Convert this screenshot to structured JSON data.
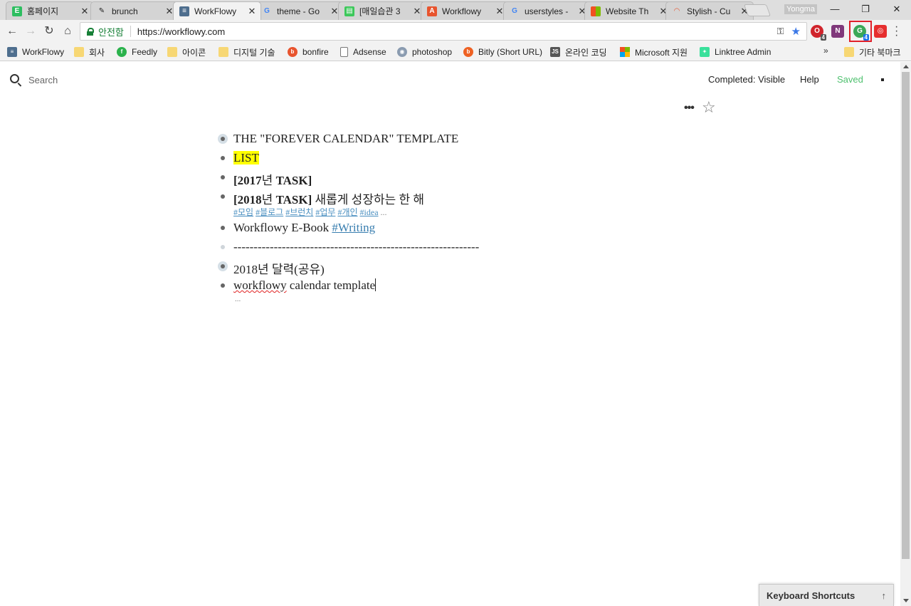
{
  "tabs": [
    {
      "title": "홈페이지",
      "icon": "evernote-icon",
      "color": "#2dbe60",
      "glyph": "E"
    },
    {
      "title": "brunch",
      "icon": "brunch-pen-icon",
      "color": "#ffffff",
      "glyph": "✎"
    },
    {
      "title": "WorkFlowy",
      "icon": "workflowy-icon",
      "color": "#4e6e8e",
      "glyph": "≡"
    },
    {
      "title": "theme - Go",
      "icon": "google-icon",
      "color": "#ffffff",
      "glyph": "G"
    },
    {
      "title": "[매일습관 3",
      "icon": "habit-icon",
      "color": "#3cc85a",
      "glyph": "▤"
    },
    {
      "title": "Workflowy",
      "icon": "workflowy-a-icon",
      "color": "#e8542e",
      "glyph": "A"
    },
    {
      "title": "userstyles -",
      "icon": "google-icon",
      "color": "#ffffff",
      "glyph": "G"
    },
    {
      "title": "Website Th",
      "icon": "microsoft-icon",
      "color": "#ffffff",
      "glyph": "▦"
    },
    {
      "title": "Stylish - Cu",
      "icon": "rainbow-icon",
      "color": "#ffffff",
      "glyph": "◠"
    }
  ],
  "window": {
    "profile": "Yongma",
    "minimize": "—",
    "restore": "❐",
    "close": "✕"
  },
  "address": {
    "secure_label": "안전함",
    "url": "https://workflowy.com"
  },
  "extensions": [
    {
      "name": "opera-ext-icon",
      "glyph": "O",
      "color": "#d0242c",
      "badge": "4",
      "badge_color": "#555"
    },
    {
      "name": "onenote-ext-icon",
      "glyph": "N",
      "color": "#80397b",
      "badge": "",
      "badge_color": "#555"
    },
    {
      "name": "grammarly-ext-icon",
      "glyph": "G",
      "color": "#3aa757",
      "badge": "4",
      "badge_color": "#1a73e8"
    },
    {
      "name": "owl-ext-icon",
      "glyph": "◎",
      "color": "#e62e2e",
      "badge": "",
      "badge_color": "#555"
    }
  ],
  "bookmarks": [
    {
      "label": "WorkFlowy",
      "icon": "workflowy-icon",
      "kind": "site",
      "color": "#4e6e8e",
      "glyph": "≡"
    },
    {
      "label": "회사",
      "icon": "folder-icon",
      "kind": "folder",
      "color": "#f7d774",
      "glyph": ""
    },
    {
      "label": "Feedly",
      "icon": "feedly-icon",
      "kind": "site",
      "color": "#2bb24c",
      "glyph": "f"
    },
    {
      "label": "아이콘",
      "icon": "folder-icon",
      "kind": "folder",
      "color": "#f7d774",
      "glyph": ""
    },
    {
      "label": "디지털 기술",
      "icon": "folder-icon",
      "kind": "folder",
      "color": "#f7d774",
      "glyph": ""
    },
    {
      "label": "bonfire",
      "icon": "bonfire-icon",
      "kind": "site",
      "color": "#e8542e",
      "glyph": "b"
    },
    {
      "label": "Adsense",
      "icon": "page-icon",
      "kind": "site",
      "color": "#ffffff",
      "glyph": ""
    },
    {
      "label": "photoshop",
      "icon": "photoshop-icon",
      "kind": "site",
      "color": "#8a9bb0",
      "glyph": "◉"
    },
    {
      "label": "Bitly (Short URL)",
      "icon": "bitly-icon",
      "kind": "site",
      "color": "#ee6123",
      "glyph": "b"
    },
    {
      "label": "온라인 코딩",
      "icon": "jsfiddle-icon",
      "kind": "site",
      "color": "#555555",
      "glyph": "JS"
    },
    {
      "label": "Microsoft 지원",
      "icon": "microsoft-icon",
      "kind": "site",
      "color": "#f25022",
      "glyph": ""
    },
    {
      "label": "Linktree Admin",
      "icon": "linktree-icon",
      "kind": "site",
      "color": "#39e09b",
      "glyph": "✦"
    }
  ],
  "bookmarks_more": "»",
  "other_bookmarks": "기타 북마크",
  "header": {
    "search_placeholder": "Search",
    "completed": "Completed: Visible",
    "help": "Help",
    "saved": "Saved"
  },
  "outline": {
    "items": [
      {
        "text": "THE \"FOREVER CALENDAR\" TEMPLATE"
      },
      {
        "text": "LIST"
      },
      {
        "bold": "[2017",
        "rest": "년",
        "bold2": " TASK]"
      },
      {
        "bold": "[2018",
        "rest": "년",
        "bold2": " TASK]",
        "suffix": " 새롭게 성장하는 한 해"
      },
      {
        "text": "Workflowy E-Book ",
        "tag": "#Writing"
      },
      {
        "text": "-------------------------------------------------------------"
      },
      {
        "text": "2018년 달력(공유)"
      },
      {
        "misspelled": "workflowy",
        "text": " calendar template"
      }
    ],
    "tags_line": [
      "#모임",
      "#블로그",
      "#브런치",
      "#업무",
      "#개인",
      "#idea"
    ],
    "tags_more": "...",
    "more": "..."
  },
  "keyboard_shortcuts": {
    "label": "Keyboard Shortcuts",
    "arrow": "↑"
  },
  "colors": {
    "saved": "#4fc16f",
    "highlight": "#ffff00",
    "tag": "#3a7fb0"
  }
}
